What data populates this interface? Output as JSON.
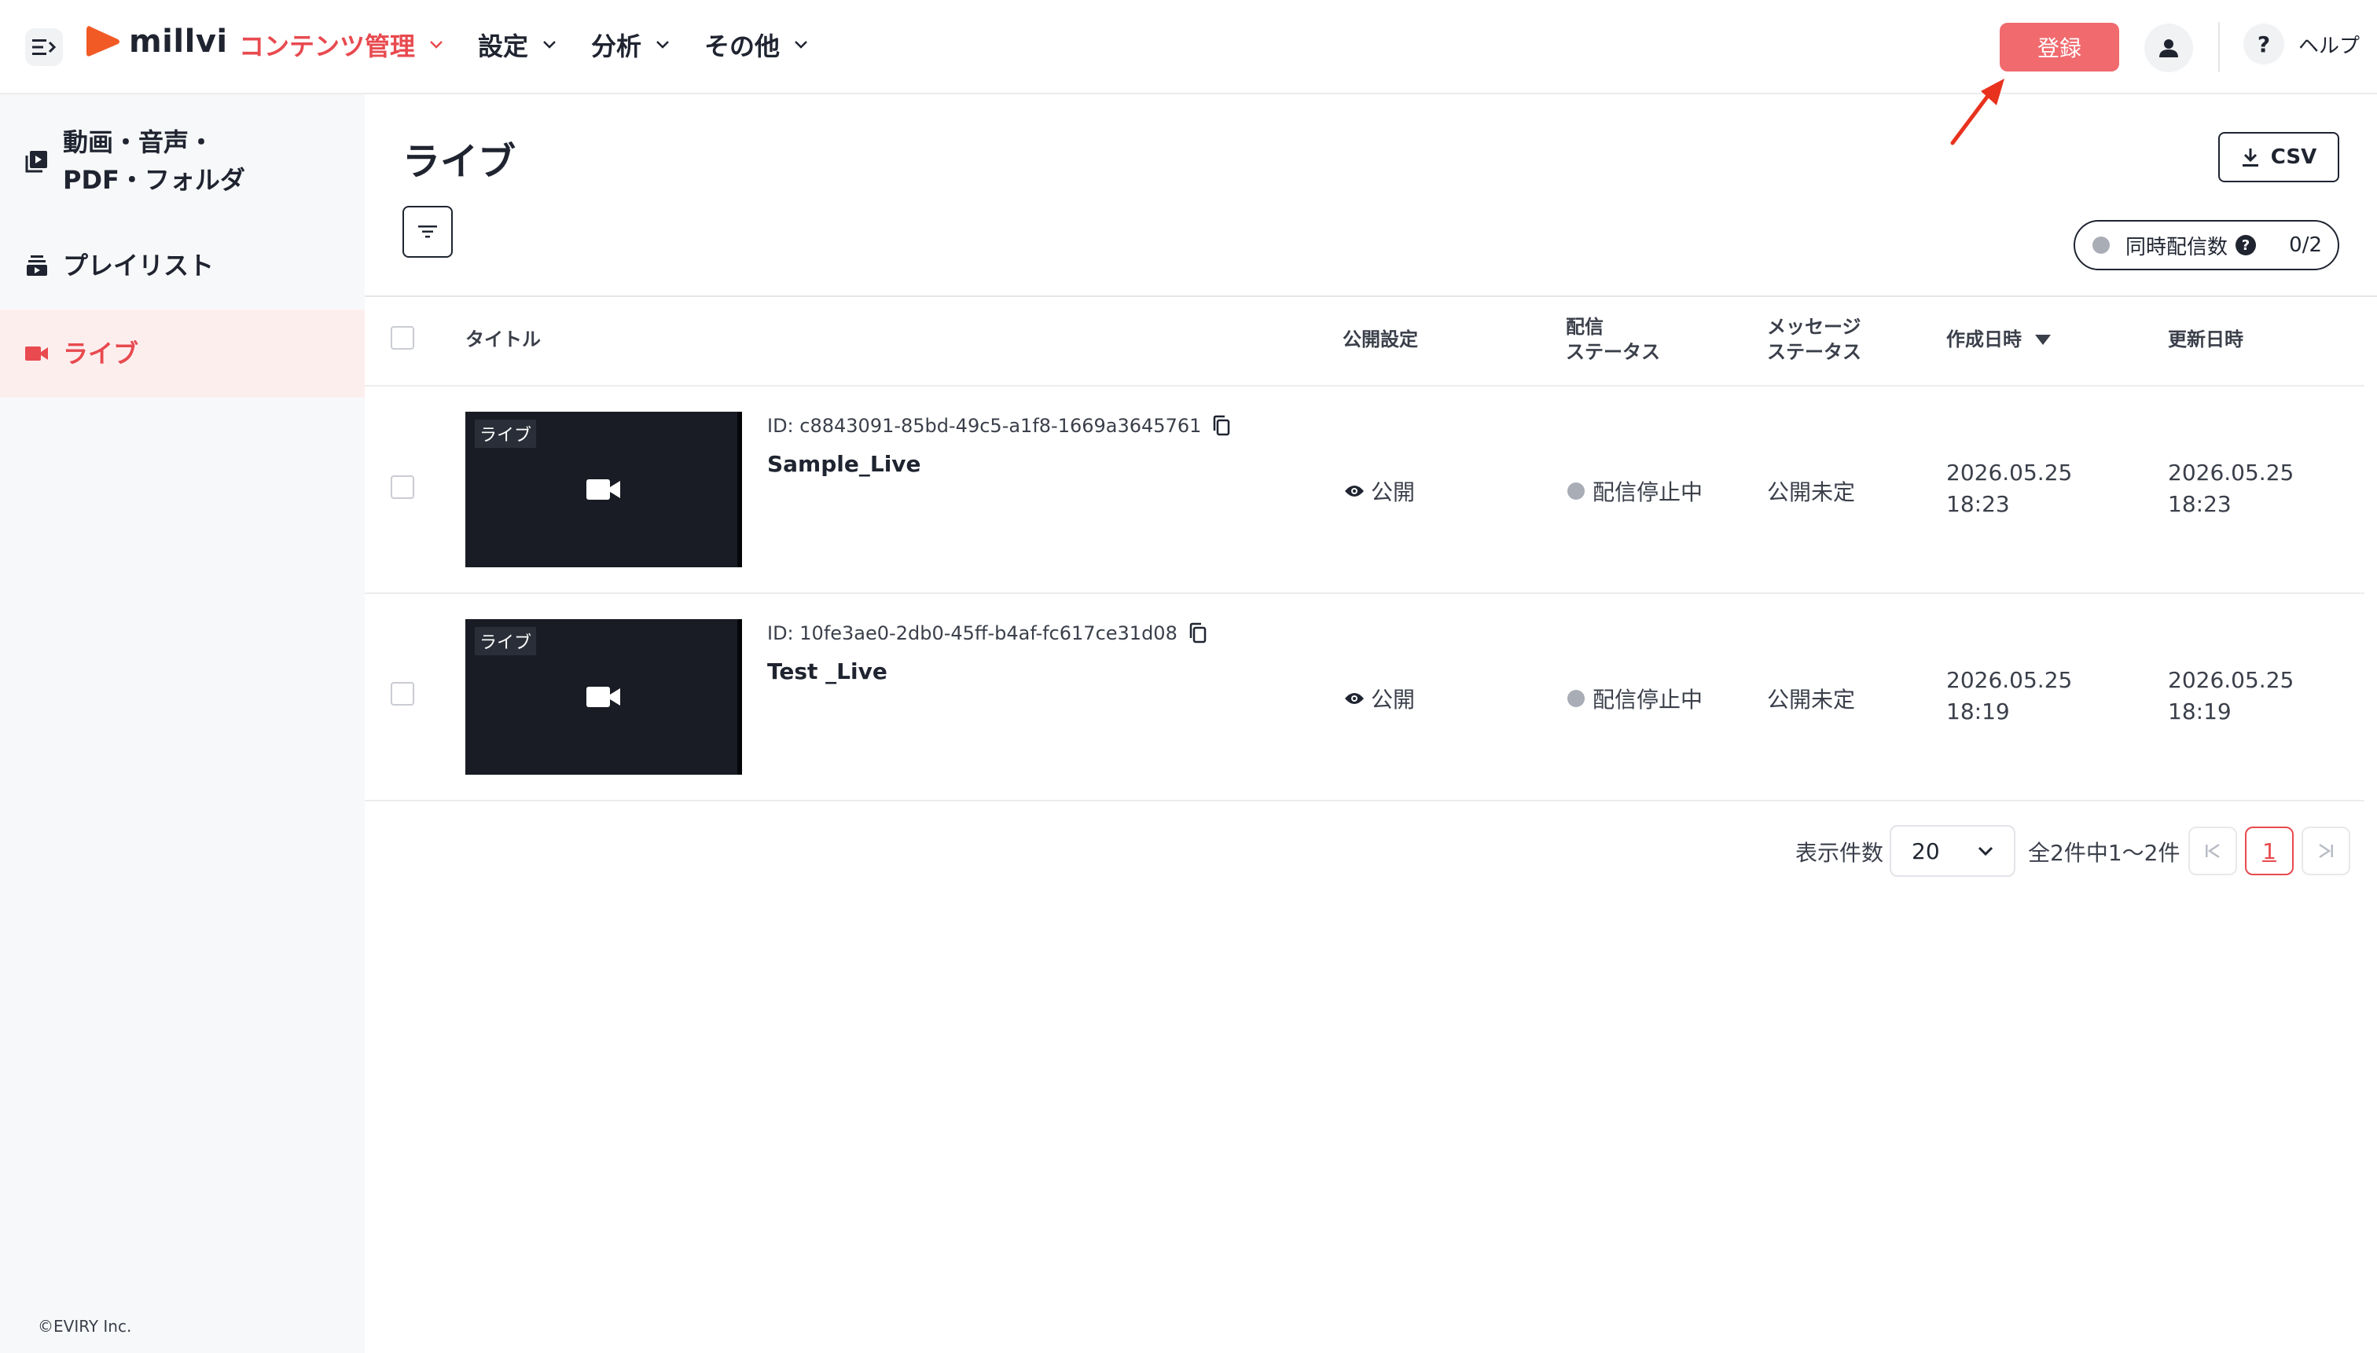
{
  "header": {
    "logo_text": "millvi",
    "nav": {
      "content": "コンテンツ管理",
      "settings": "設定",
      "analysis": "分析",
      "other": "その他"
    },
    "register_label": "登録",
    "help_label": "ヘルプ",
    "help_symbol": "?"
  },
  "sidebar": {
    "items": [
      {
        "label_line1": "動画・音声・",
        "label_line2": "PDF・フォルダ",
        "icon": "video-library-icon"
      },
      {
        "label": "プレイリスト",
        "icon": "playlist-icon"
      },
      {
        "label": "ライブ",
        "icon": "videocam-icon",
        "active": true
      }
    ],
    "copyright": "©EVIRY Inc."
  },
  "main": {
    "title": "ライブ",
    "csv_label": "CSV",
    "concurrent": {
      "label": "同時配信数",
      "help": "?",
      "count": "0/2"
    }
  },
  "table": {
    "headers": {
      "title": "タイトル",
      "visibility": "公開設定",
      "stream_status_1": "配信",
      "stream_status_2": "ステータス",
      "message_status_1": "メッセージ",
      "message_status_2": "ステータス",
      "created": "作成日時",
      "updated": "更新日時"
    },
    "rows": [
      {
        "thumb_tag": "ライブ",
        "id": "ID: c8843091-85bd-49c5-a1f8-1669a3645761",
        "title": "Sample_Live",
        "visibility": "公開",
        "stream_status": "配信停止中",
        "message_status": "公開未定",
        "created_date": "2026.05.25",
        "created_time": "18:23",
        "updated_date": "2026.05.25",
        "updated_time": "18:23"
      },
      {
        "thumb_tag": "ライブ",
        "id": "ID: 10fe3ae0-2db0-45ff-b4af-fc617ce31d08",
        "title": "Test _Live",
        "visibility": "公開",
        "stream_status": "配信停止中",
        "message_status": "公開未定",
        "created_date": "2026.05.25",
        "created_time": "18:19",
        "updated_date": "2026.05.25",
        "updated_time": "18:19"
      }
    ]
  },
  "pagination": {
    "per_page_label": "表示件数",
    "per_page_value": "20",
    "range": "全2件中1〜2件",
    "current_page": "1"
  },
  "colors": {
    "accent": "#e84a4f",
    "register_button": "#f06a6e",
    "sidebar_bg": "#f7f8f9",
    "active_item_bg": "#fdeeee",
    "annotation_arrow": "#e8321e"
  }
}
